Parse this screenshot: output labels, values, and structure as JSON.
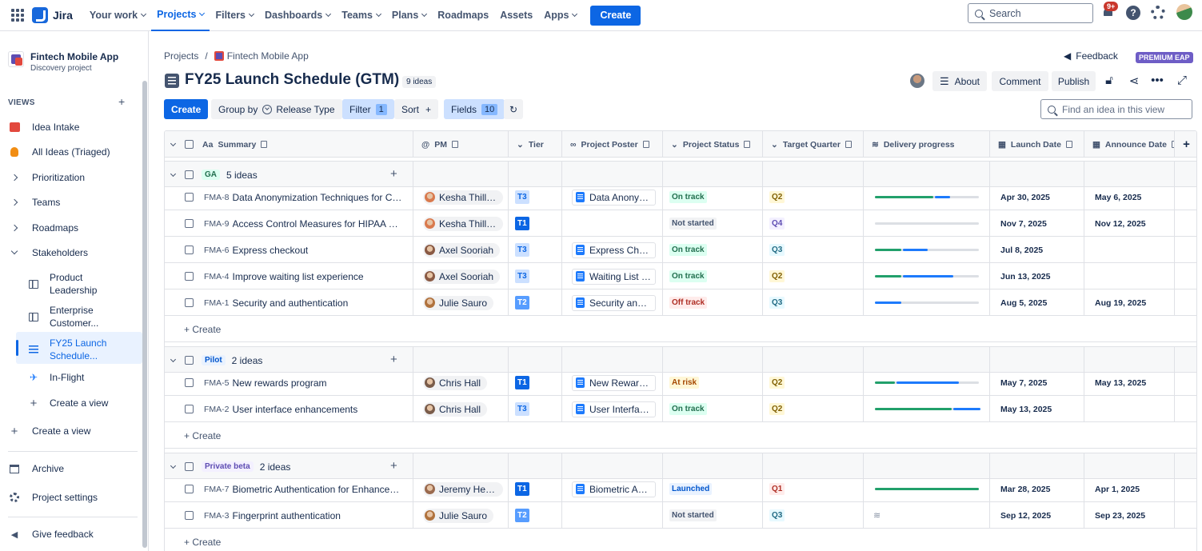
{
  "topnav": {
    "product": "Jira",
    "items": [
      {
        "label": "Your work",
        "chev": true,
        "active": false
      },
      {
        "label": "Projects",
        "chev": true,
        "active": true
      },
      {
        "label": "Filters",
        "chev": true,
        "active": false
      },
      {
        "label": "Dashboards",
        "chev": true,
        "active": false
      },
      {
        "label": "Teams",
        "chev": true,
        "active": false
      },
      {
        "label": "Plans",
        "chev": true,
        "active": false
      },
      {
        "label": "Roadmaps",
        "chev": false,
        "active": false
      },
      {
        "label": "Assets",
        "chev": false,
        "active": false
      },
      {
        "label": "Apps",
        "chev": true,
        "active": false
      }
    ],
    "create_label": "Create",
    "search_placeholder": "Search",
    "notifications_badge": "9+",
    "help_glyph": "?"
  },
  "sidebar": {
    "project_name": "Fintech Mobile App",
    "project_type": "Discovery project",
    "views_heading": "VIEWS",
    "items": [
      {
        "label": "Idea Intake",
        "icon": "mail-icon"
      },
      {
        "label": "All Ideas (Triaged)",
        "icon": "bulb-icon"
      },
      {
        "label": "Prioritization",
        "icon": "chevron-right-icon"
      },
      {
        "label": "Teams",
        "icon": "chevron-right-icon"
      },
      {
        "label": "Roadmaps",
        "icon": "chevron-right-icon"
      },
      {
        "label": "Stakeholders",
        "icon": "chevron-down-icon"
      }
    ],
    "sub_items": [
      {
        "label1": "Product",
        "label2": "Leadership",
        "icon": "board-icon"
      },
      {
        "label1": "Enterprise",
        "label2": "Customer...",
        "icon": "board-icon"
      },
      {
        "label1": "FY25 Launch",
        "label2": "Schedule...",
        "icon": "list-icon",
        "selected": true
      },
      {
        "label1": "In-Flight",
        "label2": "",
        "icon": "plane-icon"
      },
      {
        "label1": "Create a view",
        "label2": "",
        "icon": "plus-icon"
      }
    ],
    "create_view": "Create a view",
    "archive": "Archive",
    "settings": "Project settings",
    "give_feedback": "Give feedback"
  },
  "header": {
    "breadcrumb_root": "Projects",
    "breadcrumb_sep": "/",
    "breadcrumb_project": "Fintech Mobile App",
    "feedback": "Feedback",
    "premium": "PREMIUM EAP",
    "title": "FY25 Launch Schedule (GTM)",
    "idea_count": "9 ideas",
    "about": "About",
    "comment": "Comment",
    "publish": "Publish"
  },
  "toolbar": {
    "create": "Create",
    "group_by": "Group by",
    "group_value": "Release Type",
    "filter": "Filter",
    "filter_count": "1",
    "sort": "Sort",
    "sort_plus": "+",
    "fields": "Fields",
    "fields_count": "10",
    "find_placeholder": "Find an idea in this view"
  },
  "columns": [
    {
      "label": "Summary",
      "prefix": "Aa",
      "field": true
    },
    {
      "label": "PM",
      "prefix": "@",
      "field": true
    },
    {
      "label": "Tier",
      "prefix": "⌄",
      "field": false
    },
    {
      "label": "Project Poster",
      "prefix": "∞",
      "field": true
    },
    {
      "label": "Project Status",
      "prefix": "⌄",
      "field": true
    },
    {
      "label": "Target Quarter",
      "prefix": "⌄",
      "field": true
    },
    {
      "label": "Delivery progress",
      "prefix": "≋",
      "field": false
    },
    {
      "label": "Launch Date",
      "prefix": "▦",
      "field": true
    },
    {
      "label": "Announce Date",
      "prefix": "▦",
      "field": true
    }
  ],
  "create_row_label": "+ Create",
  "groups": [
    {
      "tag": "GA",
      "tag_bg": "#dcfff1",
      "tag_color": "#216e4e",
      "count": "5 ideas",
      "rows": [
        {
          "key": "FMA-8",
          "summary": "Data Anonymization Techniques for CCPA Compliance",
          "pm": "Kesha Thillainathan",
          "pm_color": "#d97a4e",
          "tier": "T3",
          "poster": "Data Anonymization",
          "status": "On track",
          "q": "Q2",
          "g": 0.56,
          "b": 0.15,
          "launch": "Apr 30, 2025",
          "announce": "May 6, 2025"
        },
        {
          "key": "FMA-9",
          "summary": "Access Control Measures for HIPAA Compliance",
          "pm": "Kesha Thillainathan",
          "pm_color": "#d97a4e",
          "tier": "T1",
          "poster": "",
          "status": "Not started",
          "q": "Q4",
          "g": 0,
          "b": 0,
          "launch": "Nov 7, 2025",
          "announce": "Nov 12, 2025"
        },
        {
          "key": "FMA-6",
          "summary": "Express checkout",
          "pm": "Axel Sooriah",
          "pm_color": "#8a5a44",
          "tier": "T3",
          "poster": "Express Checkout",
          "status": "On track",
          "q": "Q3",
          "g": 0.25,
          "b": 0.24,
          "launch": "Jul 8, 2025",
          "announce": ""
        },
        {
          "key": "FMA-4",
          "summary": "Improve waiting list experience",
          "pm": "Axel Sooriah",
          "pm_color": "#8a5a44",
          "tier": "T3",
          "poster": "Waiting List Redesign",
          "status": "On track",
          "q": "Q2",
          "g": 0.25,
          "b": 0.49,
          "launch": "Jun 13, 2025",
          "announce": ""
        },
        {
          "key": "FMA-1",
          "summary": "Security and authentication",
          "pm": "Julie Sauro",
          "pm_color": "#b0723d",
          "tier": "T2",
          "poster": "Security and Authentication",
          "status": "Off track",
          "q": "Q3",
          "g": 0,
          "b": 0.25,
          "launch": "Aug 5, 2025",
          "announce": "Aug 19, 2025"
        }
      ]
    },
    {
      "tag": "Pilot",
      "tag_bg": "#e9f2ff",
      "tag_color": "#0055cc",
      "count": "2 ideas",
      "rows": [
        {
          "key": "FMA-5",
          "summary": "New rewards program",
          "pm": "Chris Hall",
          "pm_color": "#7a5c4a",
          "tier": "T1",
          "poster": "New Rewards Program",
          "status": "At risk",
          "q": "Q2",
          "g": 0.19,
          "b": 0.6,
          "launch": "May 7, 2025",
          "announce": "May 13, 2025"
        },
        {
          "key": "FMA-2",
          "summary": "User interface enhancements",
          "pm": "Chris Hall",
          "pm_color": "#7a5c4a",
          "tier": "T3",
          "poster": "User Interface Enhancements",
          "status": "On track",
          "q": "Q2",
          "g": 0.74,
          "b": 0.26,
          "launch": "May 13, 2025",
          "announce": ""
        }
      ]
    },
    {
      "tag": "Private beta",
      "tag_bg": "#f3f0ff",
      "tag_color": "#5e4db2",
      "count": "2 ideas",
      "rows": [
        {
          "key": "FMA-7",
          "summary": "Biometric Authentication for Enhanced Security",
          "pm": "Jeremy Hernandez",
          "pm_color": "#9a6a4e",
          "tier": "T1",
          "poster": "Biometric Authentication",
          "status": "Launched",
          "q": "Q1",
          "g": 1.0,
          "b": 0,
          "launch": "Mar 28, 2025",
          "announce": "Apr 1, 2025"
        },
        {
          "key": "FMA-3",
          "summary": "Fingerprint authentication",
          "pm": "Julie Sauro",
          "pm_color": "#b0723d",
          "tier": "T2",
          "poster": "",
          "status": "Not started",
          "q": "Q3",
          "g": -1,
          "b": 0,
          "launch": "Sep 12, 2025",
          "announce": "Sep 23, 2025"
        }
      ]
    }
  ],
  "tier_colors": {
    "T1": "#0c66e4",
    "T2": "#579dff",
    "T3": "#e9f2ff"
  },
  "status_styles": {
    "On track": {
      "bg": "#dcfff1",
      "color": "#216e4e"
    },
    "Not started": {
      "bg": "#f1f2f4",
      "color": "#44546f"
    },
    "Off track": {
      "bg": "#ffeceb",
      "color": "#ae2e24"
    },
    "At risk": {
      "bg": "#fff7d6",
      "color": "#a54800"
    },
    "Launched": {
      "bg": "#e9f2ff",
      "color": "#0055cc"
    }
  },
  "quarter_styles": {
    "Q1": {
      "bg": "#ffeceb",
      "color": "#ae2e24"
    },
    "Q2": {
      "bg": "#fff7d6",
      "color": "#7f5f01"
    },
    "Q3": {
      "bg": "#e7f9ff",
      "color": "#206a83"
    },
    "Q4": {
      "bg": "#f3f0ff",
      "color": "#5e4db2"
    }
  }
}
